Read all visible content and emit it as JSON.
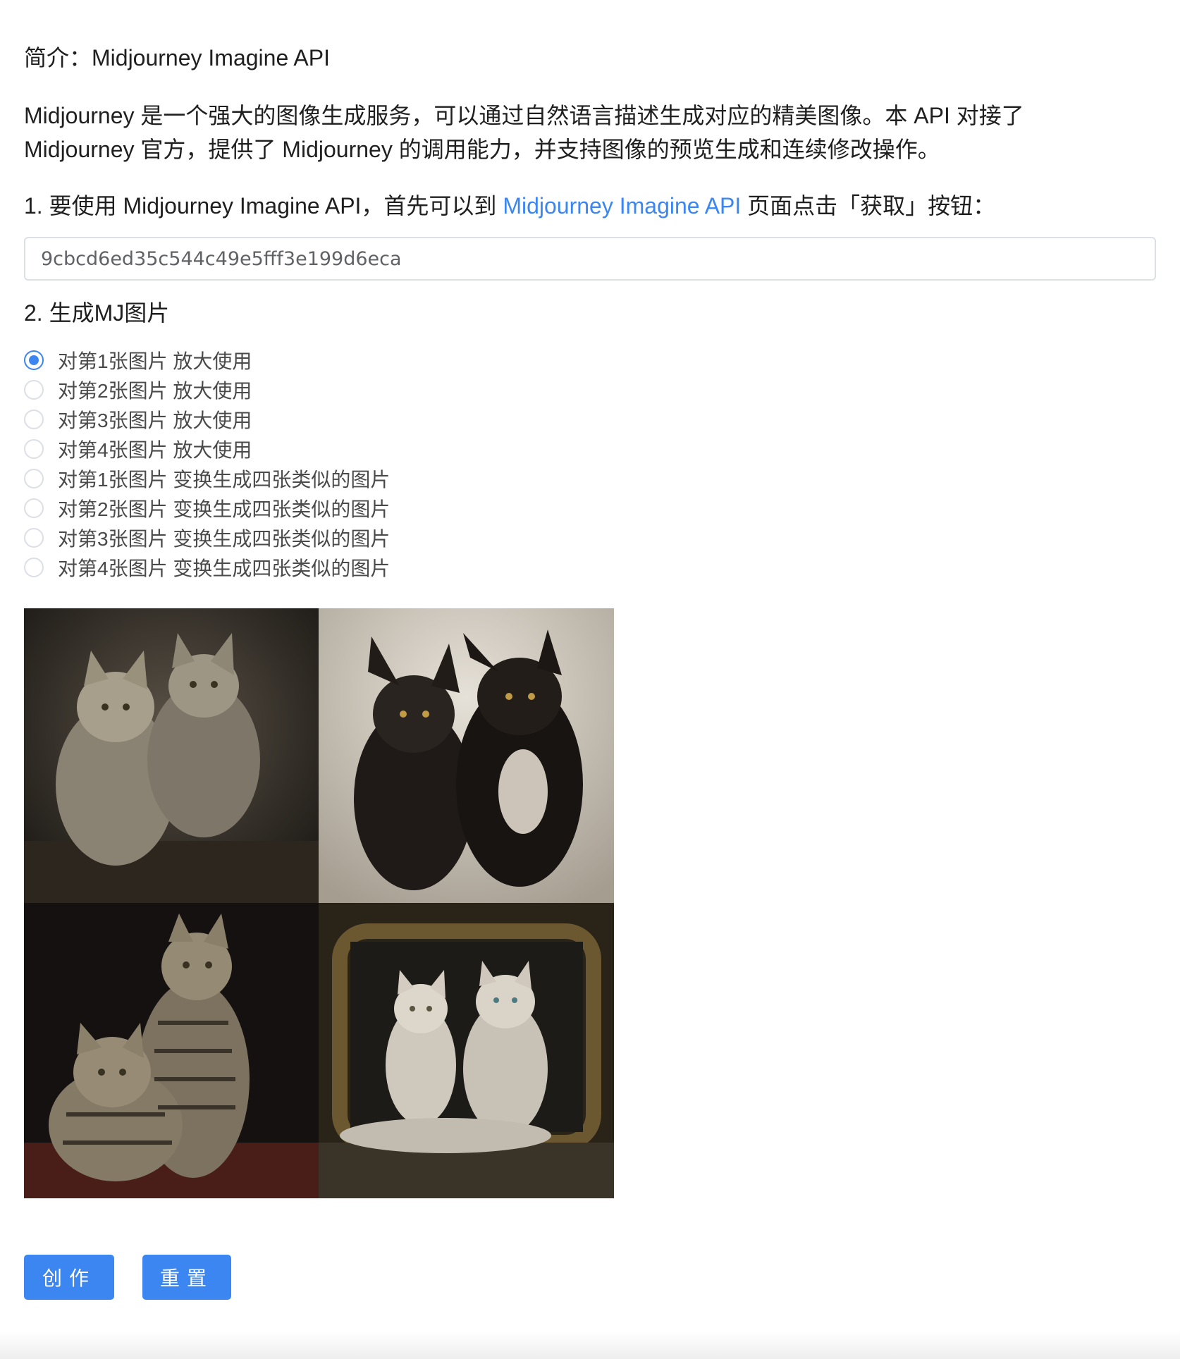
{
  "intro": {
    "heading": "简介：Midjourney Imagine API",
    "description": "Midjourney 是一个强大的图像生成服务，可以通过自然语言描述生成对应的精美图像。本 API 对接了 Midjourney 官方，提供了 Midjourney 的调用能力，并支持图像的预览生成和连续修改操作。"
  },
  "step1": {
    "prefix": "1. 要使用 Midjourney Imagine API，首先可以到 ",
    "link_text": "Midjourney Imagine API",
    "suffix": " 页面点击「获取」按钮：",
    "token_value": "9cbcd6ed35c544c49e5fff3e199d6eca"
  },
  "step2": {
    "title": "2. 生成MJ图片",
    "selected_index": 0,
    "options": [
      "对第1张图片 放大使用",
      "对第2张图片 放大使用",
      "对第3张图片 放大使用",
      "对第4张图片 放大使用",
      "对第1张图片 变换生成四张类似的图片",
      "对第2张图片 变换生成四张类似的图片",
      "对第3张图片 变换生成四张类似的图片",
      "对第4张图片 变换生成四张类似的图片"
    ]
  },
  "buttons": {
    "create_label": "创作",
    "reset_label": "重置"
  },
  "colors": {
    "accent": "#3b86f0",
    "text": "#1f1f1f",
    "border": "#dcdfe6"
  }
}
